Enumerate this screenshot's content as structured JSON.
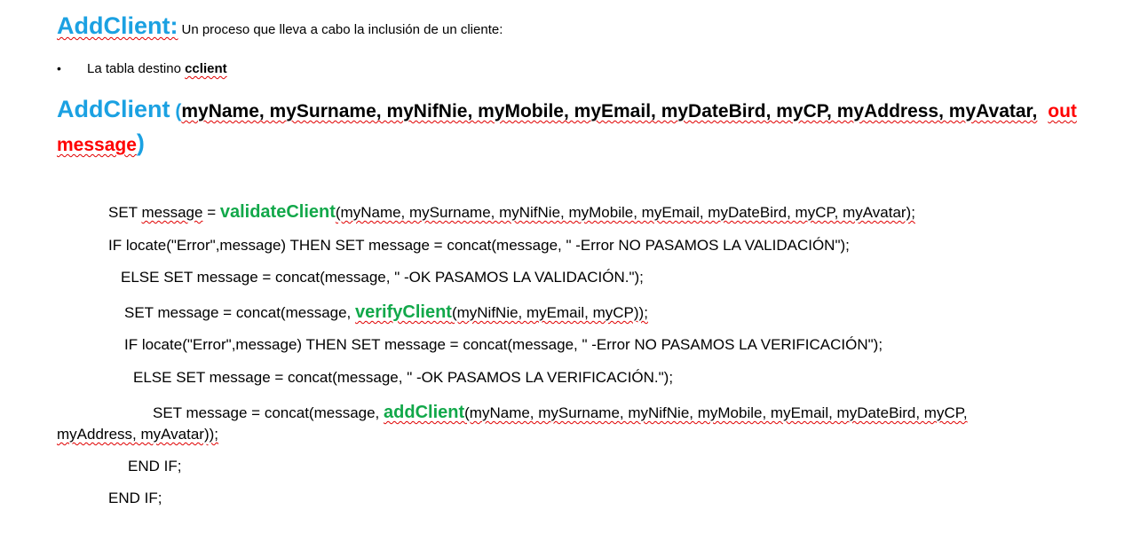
{
  "header": {
    "title": "AddClient:",
    "description": "Un proceso que lleva a cabo la inclusión de un cliente:"
  },
  "bullet": {
    "symbol": "•",
    "text": "La tabla destino ",
    "table_name": "cclient"
  },
  "signature": {
    "name": "AddClient",
    "open_paren": "(",
    "params": "myName, mySurname, myNifNie, myMobile, myEmail, myDateBird, myCP, myAddress, myAvatar,",
    "out_keyword": "out",
    "out_param": "message",
    "close_paren": ")"
  },
  "code": {
    "l1": {
      "pre": "SET ",
      "var": "message",
      "eq": " = ",
      "fn": "validateClient",
      "args": "(myName, mySurname, myNifNie, myMobile, myEmail, myDateBird, myCP, myAvatar);"
    },
    "l2": {
      "text": "IF locate(\"Error\",message) THEN SET message = concat(message, \" -Error NO PASAMOS LA VALIDACIÓN\");"
    },
    "l3": {
      "text": "ELSE SET message = concat(message, \" -OK PASAMOS LA VALIDACIÓN.\");"
    },
    "l4": {
      "pre": "SET message = concat(message, ",
      "fn": "verifyClient",
      "args": "(myNifNie, myEmail, myCP));"
    },
    "l5": {
      "text": "IF locate(\"Error\",message) THEN SET message = concat(message, \" -Error NO PASAMOS LA VERIFICACIÓN\");"
    },
    "l6": {
      "text": "ELSE SET message = concat(message, \" -OK PASAMOS LA VERIFICACIÓN.\");"
    },
    "l7": {
      "pre": "SET message = concat(message,  ",
      "fn": "addClient",
      "args": "(myName, mySurname, myNifNie, myMobile, myEmail, myDateBird, myCP,"
    },
    "l8": {
      "text": "myAddress, myAvatar));"
    },
    "l9": {
      "text": "END IF;"
    },
    "l10": {
      "text": "END IF;"
    }
  }
}
